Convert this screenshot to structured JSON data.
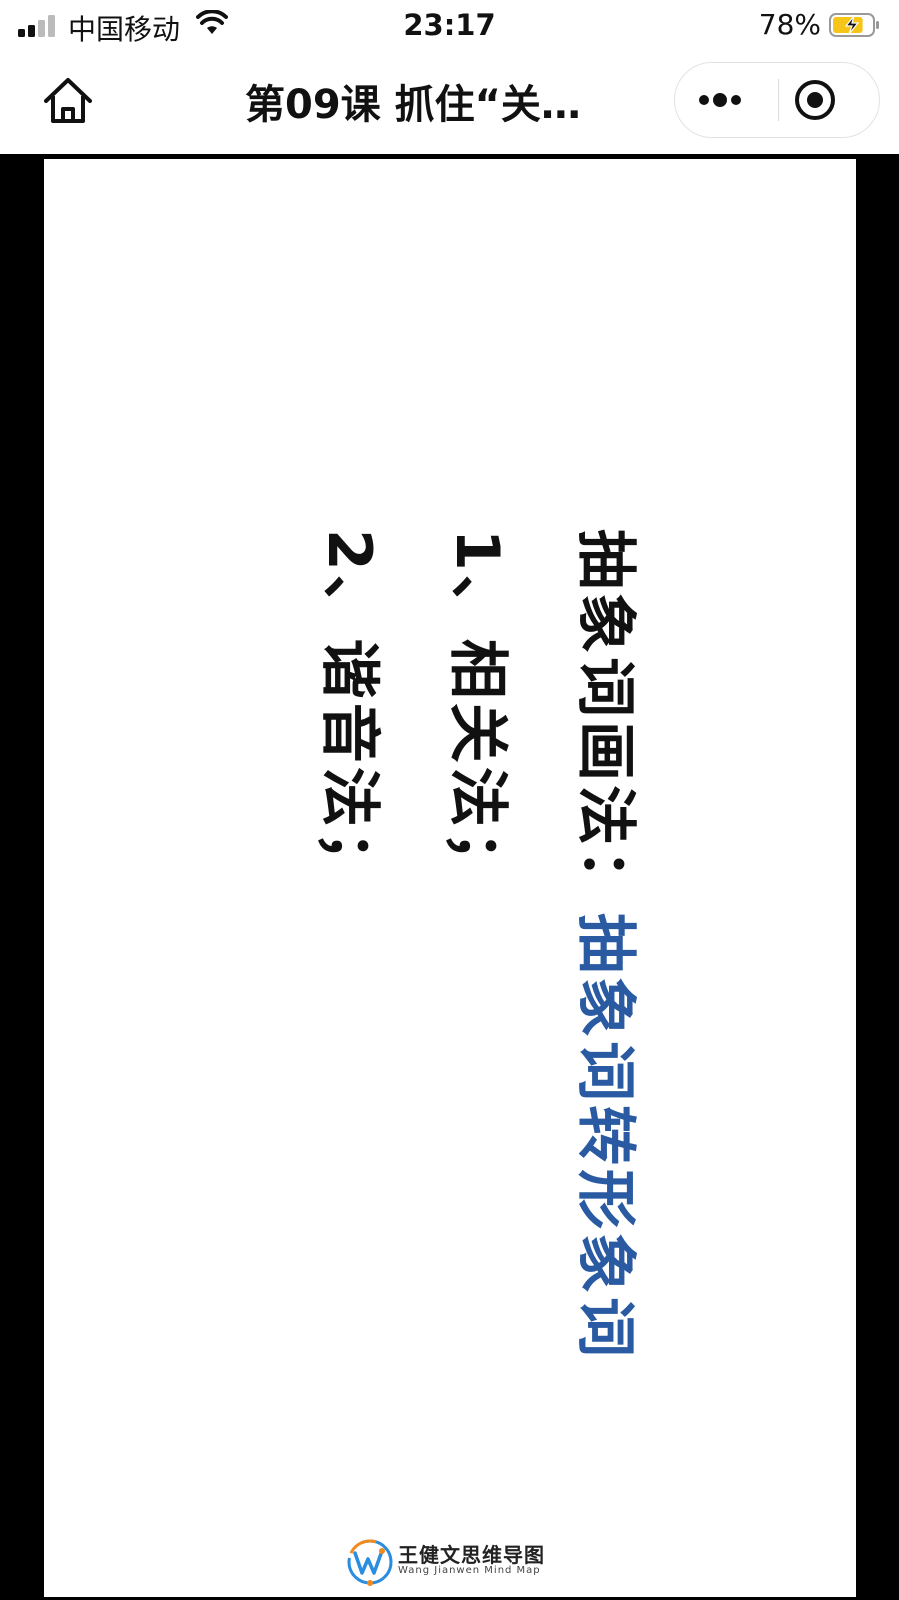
{
  "status_bar": {
    "carrier": "中国移动",
    "time": "23:17",
    "battery_percent": "78%",
    "battery_level": 0.78,
    "charging": true,
    "battery_color": "#f5c518"
  },
  "nav": {
    "title": "第09课 抓住“关…",
    "home_icon": "home-icon",
    "more_icon": "more-dots-icon",
    "close_icon": "target-close-icon"
  },
  "slide": {
    "heading_prefix": "抽象词画法：",
    "heading_accent": "抽象词转形象词",
    "item1": "1、相关法；",
    "item2": "2、谐音法；",
    "accent_color": "#2a5aa2",
    "logo": {
      "cn": "王健文思维导图",
      "en": "Wang Jianwen Mind Map"
    }
  }
}
